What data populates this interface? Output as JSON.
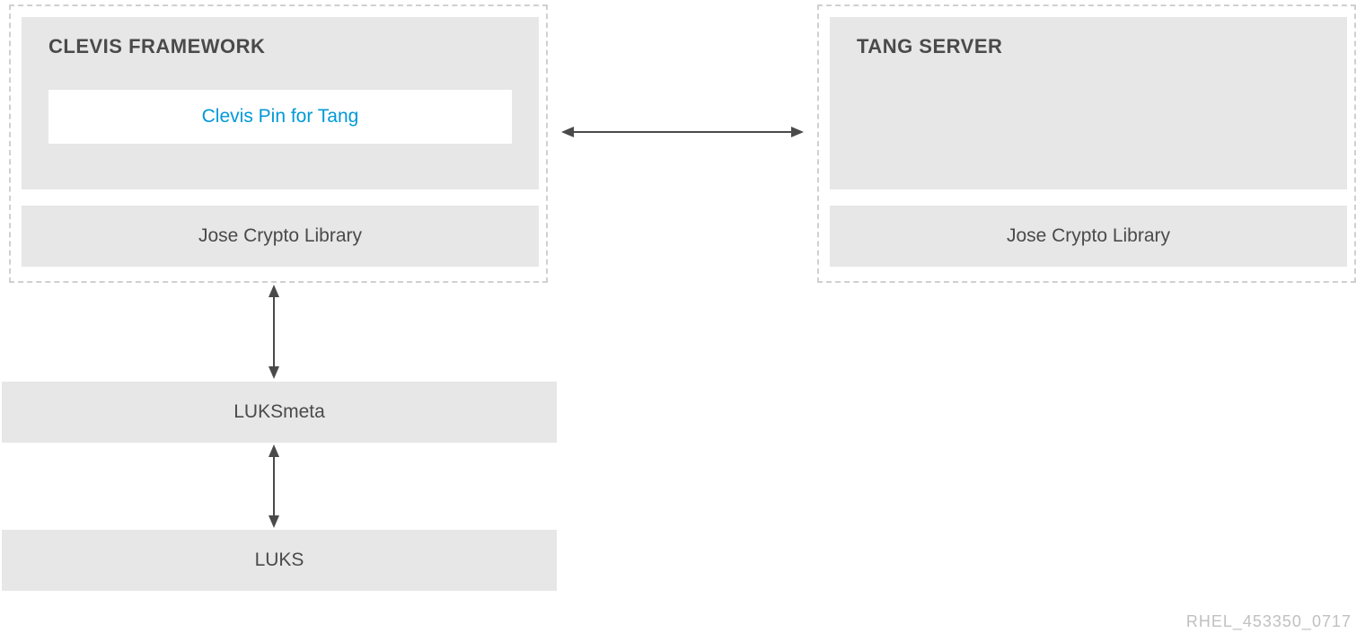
{
  "left": {
    "title": "CLEVIS FRAMEWORK",
    "pin": "Clevis Pin for Tang",
    "jose": "Jose Crypto Library"
  },
  "right": {
    "title": "TANG SERVER",
    "jose": "Jose Crypto Library"
  },
  "stack": {
    "luksmeta": "LUKSmeta",
    "luks": "LUKS"
  },
  "footer": "RHEL_453350_0717"
}
